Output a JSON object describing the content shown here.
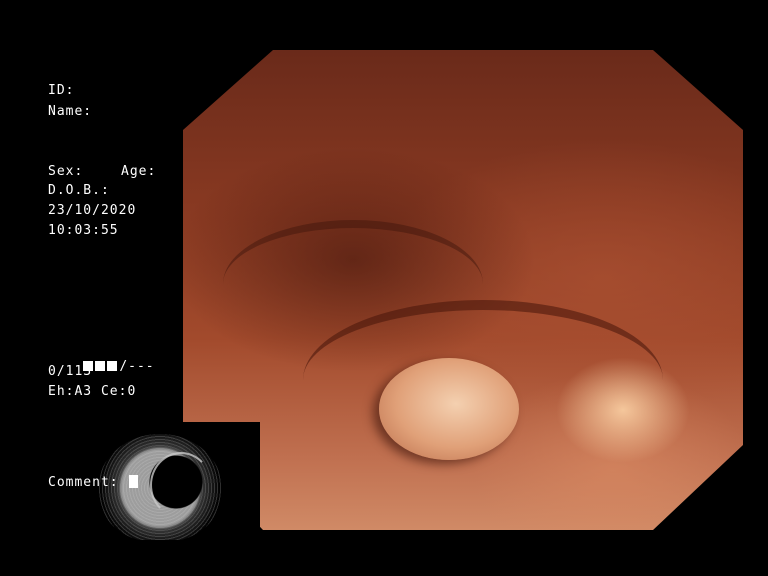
{
  "patient": {
    "id_label": "ID:",
    "name_label": "Name:",
    "sex_label": "Sex:",
    "age_label": "Age:",
    "dob_label": "D.O.B.:",
    "date": "23/10/2020",
    "time": "10:03:55"
  },
  "status": {
    "counter_suffix": "/---",
    "frame_count": "0/113",
    "settings": "Eh:A3 Ce:0"
  },
  "comment": {
    "label": "Comment:"
  },
  "colors": {
    "background": "#000000",
    "overlay_text": "#ffffff",
    "mucosa": "#a24a2c"
  }
}
